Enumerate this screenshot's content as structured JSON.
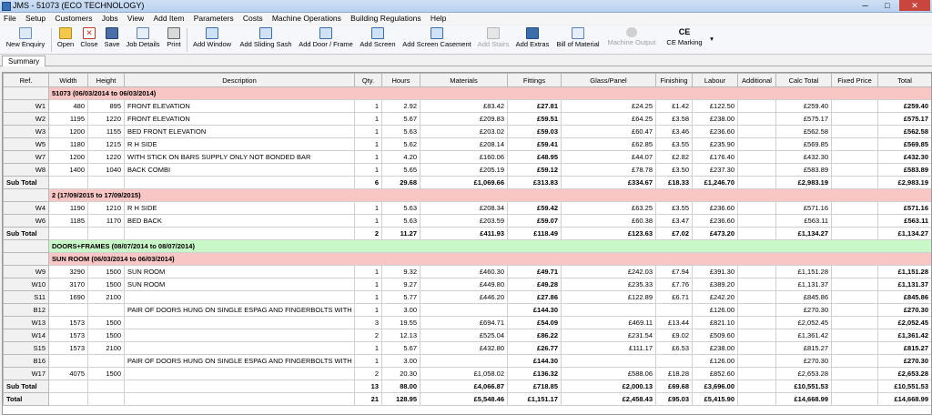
{
  "window": {
    "title": "JMS - 51073  (ECO TECHNOLOGY)",
    "minimize": "─",
    "maximize": "□",
    "close": "✕"
  },
  "menu": [
    "File",
    "Setup",
    "Customers",
    "Jobs",
    "View",
    "Add Item",
    "Parameters",
    "Costs",
    "Machine Operations",
    "Building Regulations",
    "Help"
  ],
  "toolbar": {
    "new_enquiry": "New Enquiry",
    "open": "Open",
    "close": "Close",
    "save": "Save",
    "job_details": "Job Details",
    "print": "Print",
    "add_window": "Add Window",
    "add_sliding_sash": "Add Sliding Sash",
    "add_door_frame": "Add Door / Frame",
    "add_screen": "Add Screen",
    "add_screen_casement": "Add Screen Casement",
    "add_stairs": "Add Stairs",
    "add_extras": "Add Extras",
    "bill_of_material": "Bill of Material",
    "machine_output": "Machine Output",
    "ce_marking": "CE Marking",
    "ce_icon": "CE",
    "more": "▾"
  },
  "tabs": {
    "summary": "Summary"
  },
  "columns": [
    "Ref.",
    "Width",
    "Height",
    "Description",
    "Qty.",
    "Hours",
    "Materials",
    "Fittings",
    "Glass/Panel",
    "Finishing",
    "Labour",
    "Additional",
    "Calc Total",
    "Fixed Price",
    "Total"
  ],
  "rows": [
    {
      "type": "group",
      "color": "pink",
      "label": "51073 (06/03/2014 to 06/03/2014)"
    },
    {
      "type": "item",
      "cells": [
        "W1",
        "480",
        "895",
        "FRONT ELEVATION",
        "1",
        "2.92",
        "£83.42",
        "£27.81",
        "£24.25",
        "£1.42",
        "£122.50",
        "",
        "£259.40",
        "",
        "£259.40"
      ]
    },
    {
      "type": "item",
      "cells": [
        "W2",
        "1195",
        "1220",
        "FRONT ELEVATION",
        "1",
        "5.67",
        "£209.83",
        "£59.51",
        "£64.25",
        "£3.58",
        "£238.00",
        "",
        "£575.17",
        "",
        "£575.17"
      ]
    },
    {
      "type": "item",
      "cells": [
        "W3",
        "1200",
        "1155",
        "BED FRONT ELEVATION",
        "1",
        "5.63",
        "£203.02",
        "£59.03",
        "£60.47",
        "£3.46",
        "£236.60",
        "",
        "£562.58",
        "",
        "£562.58"
      ]
    },
    {
      "type": "item",
      "cells": [
        "W5",
        "1180",
        "1215",
        "R H SIDE",
        "1",
        "5.62",
        "£208.14",
        "£59.41",
        "£62.85",
        "£3.55",
        "£235.90",
        "",
        "£569.85",
        "",
        "£569.85"
      ]
    },
    {
      "type": "item",
      "cells": [
        "W7",
        "1200",
        "1220",
        "WITH STICK ON BARS SUPPLY ONLY NOT BONDED BAR",
        "1",
        "4.20",
        "£160.06",
        "£48.95",
        "£44.07",
        "£2.82",
        "£176.40",
        "",
        "£432.30",
        "",
        "£432.30"
      ]
    },
    {
      "type": "item",
      "cells": [
        "W8",
        "1400",
        "1040",
        "BACK COMBI",
        "1",
        "5.65",
        "£205.19",
        "£59.12",
        "£78.78",
        "£3.50",
        "£237.30",
        "",
        "£583.89",
        "",
        "£583.89"
      ]
    },
    {
      "type": "subtotal",
      "cells": [
        "Sub Total",
        "",
        "",
        "",
        "6",
        "29.68",
        "£1,069.66",
        "£313.83",
        "£334.67",
        "£18.33",
        "£1,246.70",
        "",
        "£2,983.19",
        "",
        "£2,983.19"
      ]
    },
    {
      "type": "group",
      "color": "pink",
      "label": "2 (17/09/2015 to 17/09/2015)"
    },
    {
      "type": "item",
      "cells": [
        "W4",
        "1190",
        "1210",
        "R H SIDE",
        "1",
        "5.63",
        "£208.34",
        "£59.42",
        "£63.25",
        "£3.55",
        "£236.60",
        "",
        "£571.16",
        "",
        "£571.16"
      ]
    },
    {
      "type": "item",
      "cells": [
        "W6",
        "1185",
        "1170",
        "BED BACK",
        "1",
        "5.63",
        "£203.59",
        "£59.07",
        "£60.38",
        "£3.47",
        "£236.60",
        "",
        "£563.11",
        "",
        "£563.11"
      ]
    },
    {
      "type": "subtotal",
      "cells": [
        "Sub Total",
        "",
        "",
        "",
        "2",
        "11.27",
        "£411.93",
        "£118.49",
        "£123.63",
        "£7.02",
        "£473.20",
        "",
        "£1,134.27",
        "",
        "£1,134.27"
      ]
    },
    {
      "type": "group",
      "color": "green",
      "label": "DOORS+FRAMES (08/07/2014 to 08/07/2014)"
    },
    {
      "type": "group",
      "color": "pink",
      "label": "SUN ROOM (06/03/2014 to 06/03/2014)"
    },
    {
      "type": "item",
      "cells": [
        "W9",
        "3290",
        "1500",
        "SUN ROOM",
        "1",
        "9.32",
        "£460.30",
        "£49.71",
        "£242.03",
        "£7.94",
        "£391.30",
        "",
        "£1,151.28",
        "",
        "£1,151.28"
      ]
    },
    {
      "type": "item",
      "cells": [
        "W10",
        "3170",
        "1500",
        "SUN ROOM",
        "1",
        "9.27",
        "£449.80",
        "£49.28",
        "£235.33",
        "£7.76",
        "£389.20",
        "",
        "£1,131.37",
        "",
        "£1,131.37"
      ]
    },
    {
      "type": "item",
      "cells": [
        "S11",
        "1690",
        "2100",
        "",
        "1",
        "5.77",
        "£446.20",
        "£27.86",
        "£122.89",
        "£6.71",
        "£242.20",
        "",
        "£845.86",
        "",
        "£845.86"
      ]
    },
    {
      "type": "item",
      "cells": [
        "B12",
        "",
        "",
        "PAIR OF DOORS HUNG ON SINGLE ESPAG AND FINGERBOLTS WITH STD HAN",
        "1",
        "3.00",
        "",
        "£144.30",
        "",
        "",
        "£126.00",
        "",
        "£270.30",
        "",
        "£270.30"
      ]
    },
    {
      "type": "item",
      "cells": [
        "W13",
        "1573",
        "1500",
        "",
        "3",
        "19.55",
        "£694.71",
        "£54.09",
        "£469.11",
        "£13.44",
        "£821.10",
        "",
        "£2,052.45",
        "",
        "£2,052.45"
      ]
    },
    {
      "type": "item",
      "cells": [
        "W14",
        "1573",
        "1500",
        "",
        "2",
        "12.13",
        "£525.04",
        "£86.22",
        "£231.54",
        "£9.02",
        "£509.60",
        "",
        "£1,361.42",
        "",
        "£1,361.42"
      ]
    },
    {
      "type": "item",
      "cells": [
        "S15",
        "1573",
        "2100",
        "",
        "1",
        "5.67",
        "£432.80",
        "£26.77",
        "£111.17",
        "£6.53",
        "£238.00",
        "",
        "£815.27",
        "",
        "£815.27"
      ]
    },
    {
      "type": "item",
      "cells": [
        "B16",
        "",
        "",
        "PAIR OF DOORS HUNG ON SINGLE ESPAG AND FINGERBOLTS WITH STD HAN",
        "1",
        "3.00",
        "",
        "£144.30",
        "",
        "",
        "£126.00",
        "",
        "£270.30",
        "",
        "£270.30"
      ]
    },
    {
      "type": "item",
      "cells": [
        "W17",
        "4075",
        "1500",
        "",
        "2",
        "20.30",
        "£1,058.02",
        "£136.32",
        "£588.06",
        "£18.28",
        "£852.60",
        "",
        "£2,653.28",
        "",
        "£2,653.28"
      ]
    },
    {
      "type": "subtotal",
      "cells": [
        "Sub Total",
        "",
        "",
        "",
        "13",
        "88.00",
        "£4,066.87",
        "£718.85",
        "£2,000.13",
        "£69.68",
        "£3,696.00",
        "",
        "£10,551.53",
        "",
        "£10,551.53"
      ]
    },
    {
      "type": "subtotal",
      "cells": [
        "Total",
        "",
        "",
        "",
        "21",
        "128.95",
        "£5,548.46",
        "£1,151.17",
        "£2,458.43",
        "£95.03",
        "£5,415.90",
        "",
        "£14,668.99",
        "",
        "£14,668.99"
      ]
    }
  ],
  "colors": {
    "group_pink": "#f9c6c6",
    "group_green": "#c8f7c8",
    "header_bg": "#f1f1f1"
  }
}
